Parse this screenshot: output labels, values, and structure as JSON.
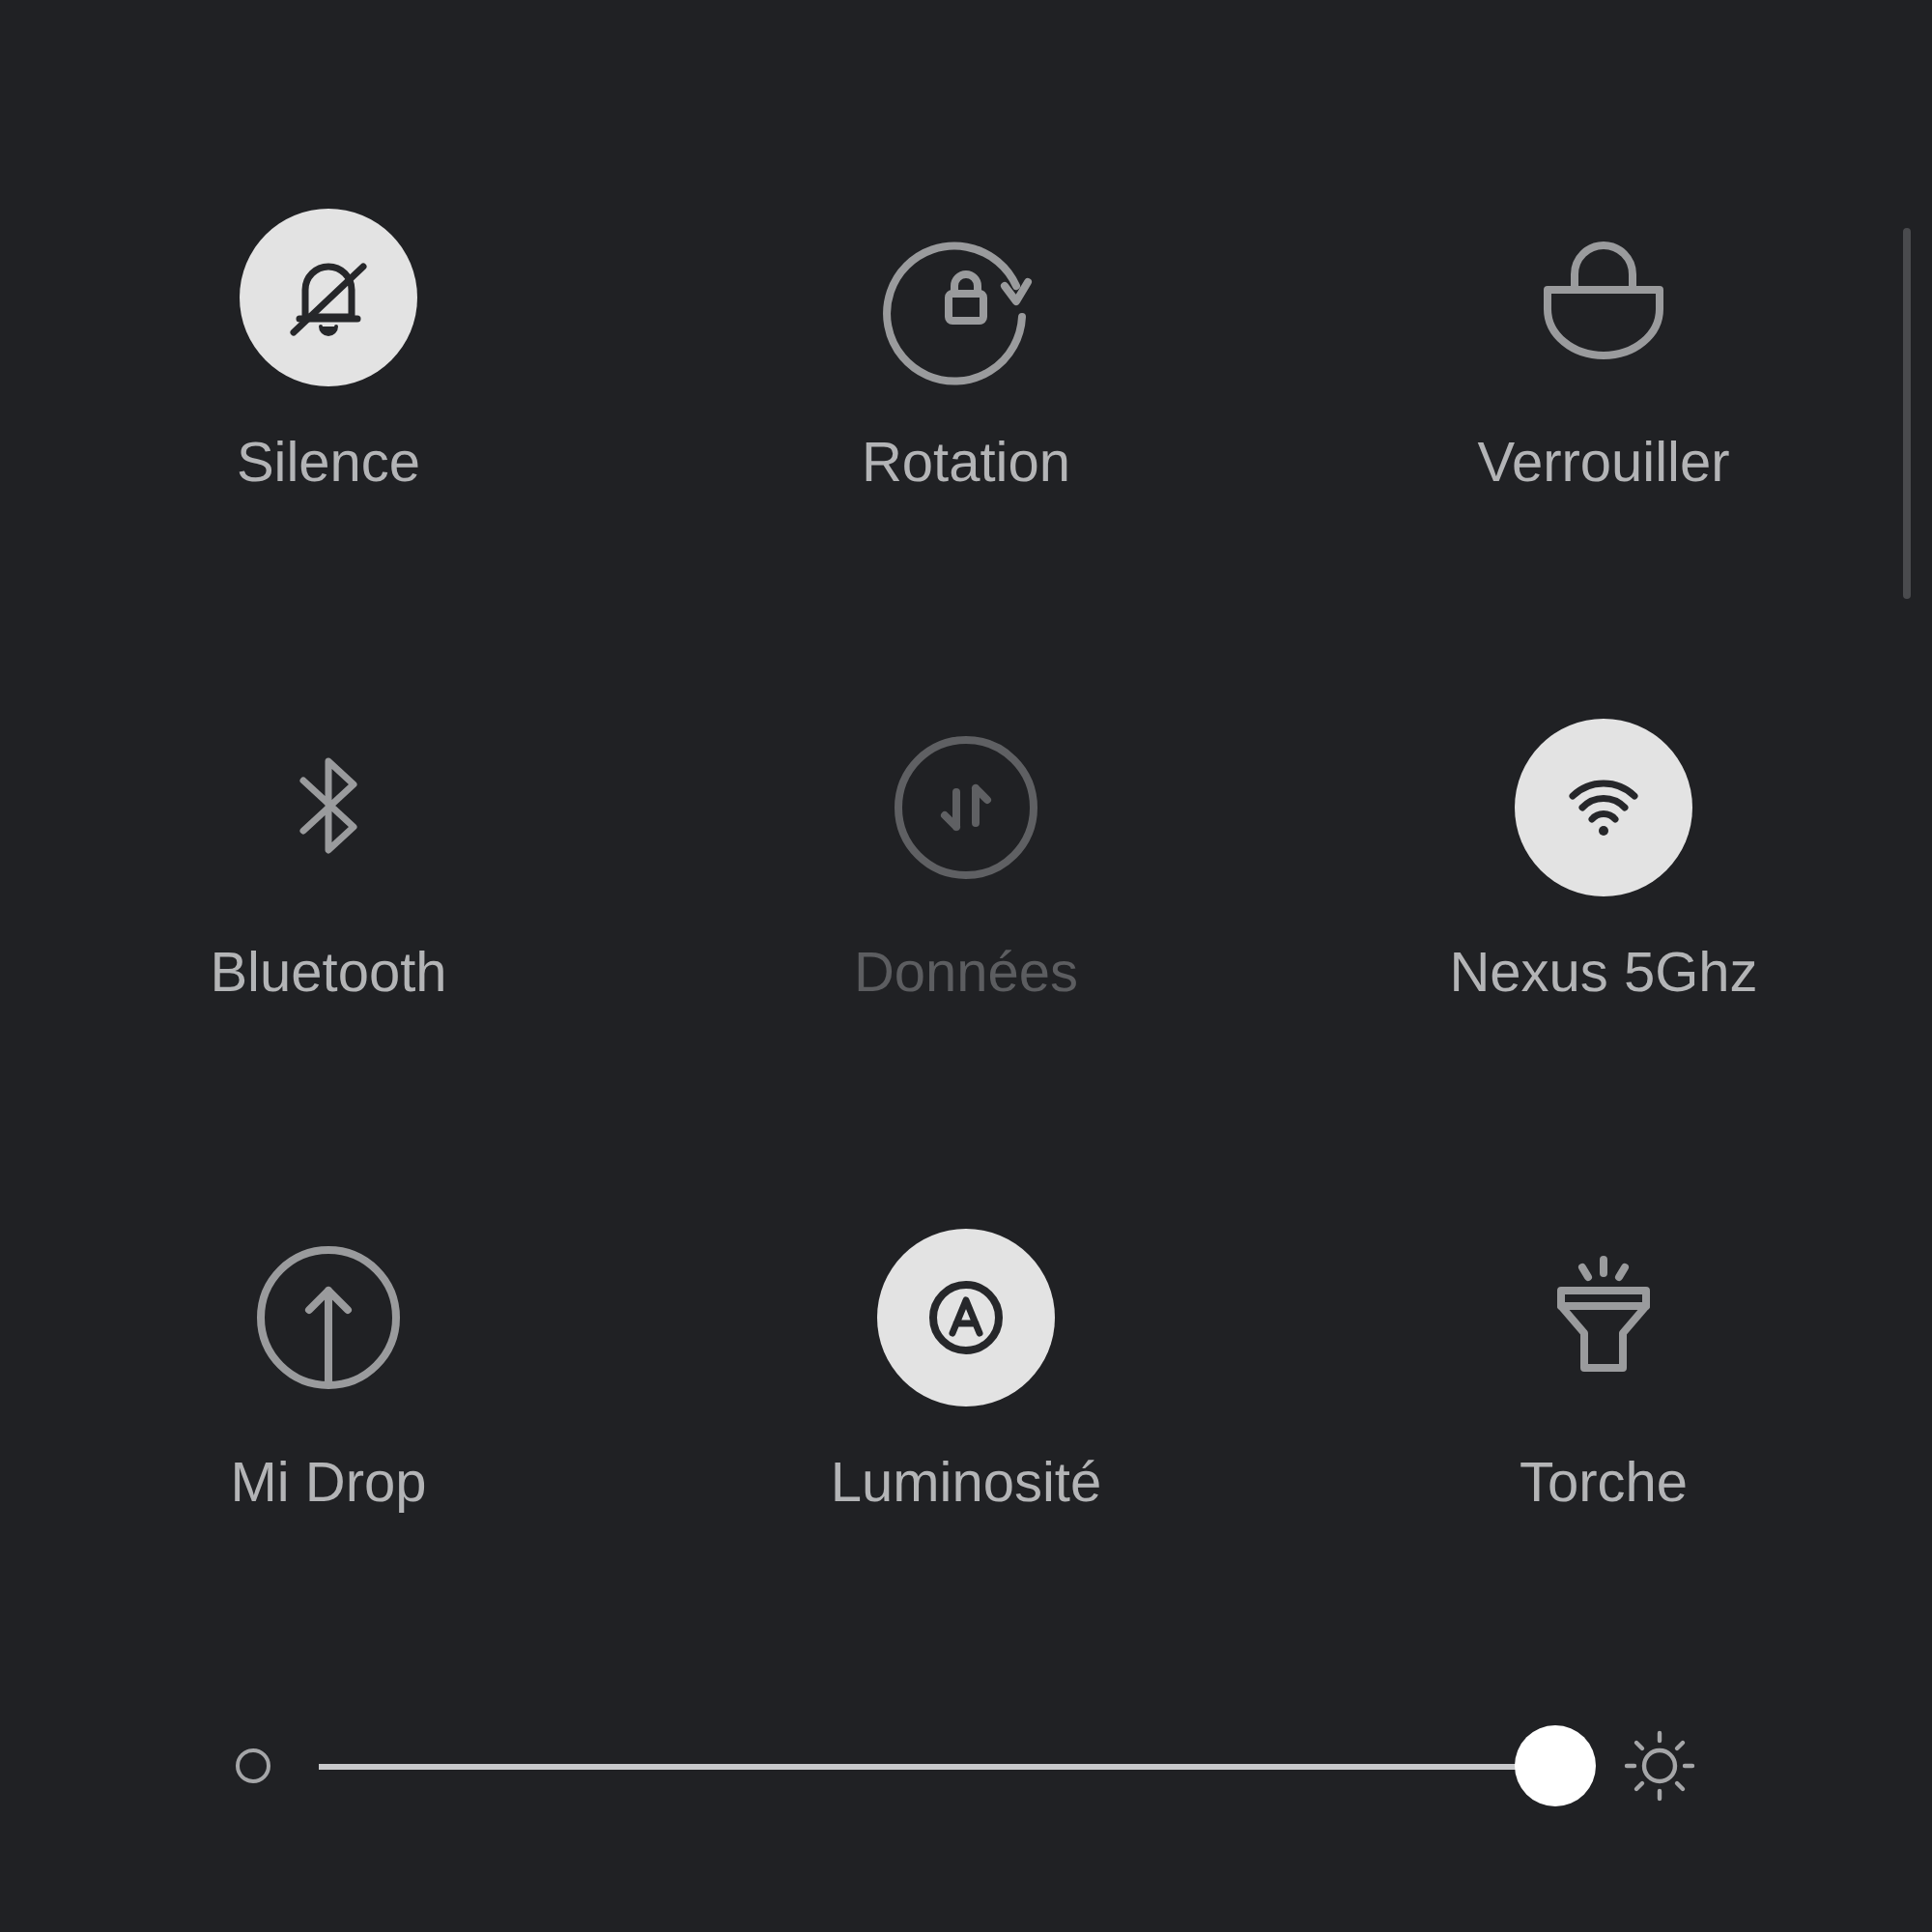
{
  "tiles": [
    {
      "label": "Silence",
      "kind": "silence",
      "on": true,
      "disabled": false
    },
    {
      "label": "Rotation",
      "kind": "rotation",
      "on": false,
      "disabled": false
    },
    {
      "label": "Verrouiller",
      "kind": "lock",
      "on": false,
      "disabled": false
    },
    {
      "label": "Bluetooth",
      "kind": "bluetooth",
      "on": false,
      "disabled": false
    },
    {
      "label": "Données",
      "kind": "data",
      "on": false,
      "disabled": true
    },
    {
      "label": "Nexus 5Ghz",
      "kind": "wifi",
      "on": true,
      "disabled": false
    },
    {
      "label": "Mi Drop",
      "kind": "upload",
      "on": false,
      "disabled": false
    },
    {
      "label": "Luminosité",
      "kind": "auto-brightness",
      "on": true,
      "disabled": false
    },
    {
      "label": "Torche",
      "kind": "torch",
      "on": false,
      "disabled": false
    }
  ],
  "brightness": {
    "level": 0.97
  }
}
